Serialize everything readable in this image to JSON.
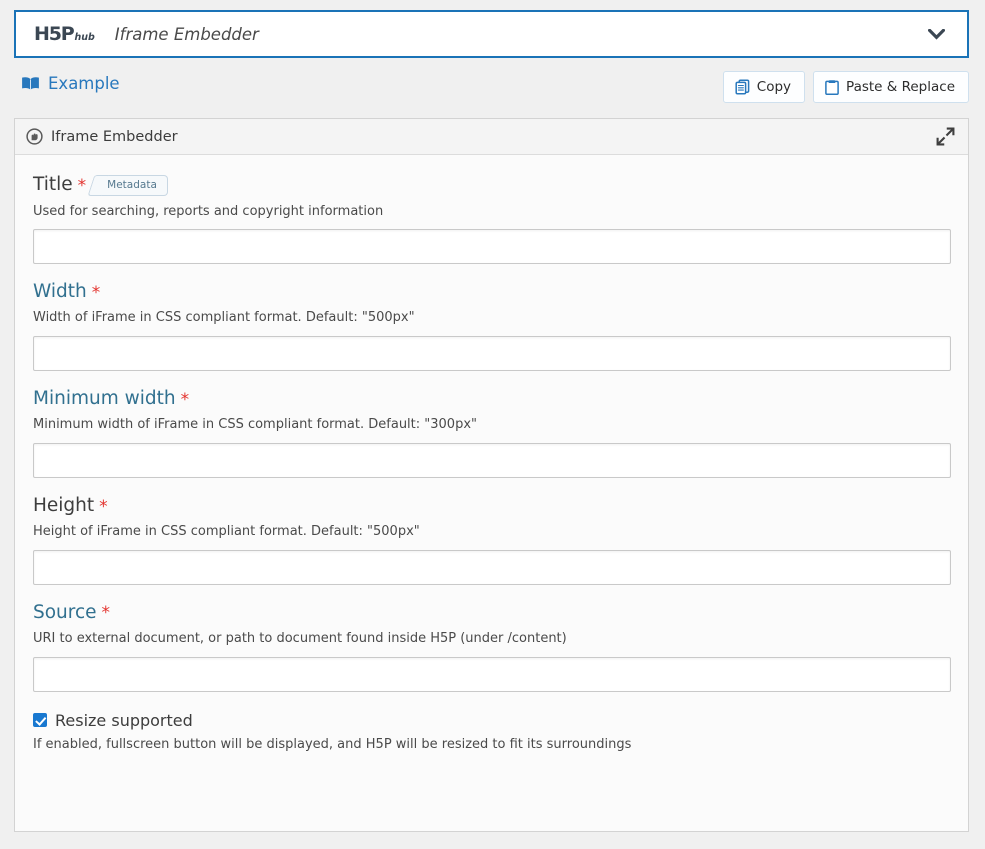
{
  "hub_header": {
    "logo_text": "H5P",
    "logo_sub": "hub",
    "title": "Iframe Embedder",
    "chevron_icon": "chevron-down-icon",
    "border_color": "#1a73b7"
  },
  "action_bar": {
    "example_label": "Example",
    "example_icon": "book-icon",
    "example_color": "#2878bd",
    "buttons": [
      {
        "label": "Copy",
        "icon": "copy-icon"
      },
      {
        "label": "Paste & Replace",
        "icon": "clipboard-icon"
      }
    ]
  },
  "panel": {
    "icon": "iframe-embedder-icon",
    "title": "Iframe Embedder",
    "expand_icon": "expand-diagonal-icon"
  },
  "fields": [
    {
      "name": "title",
      "label": "Title",
      "required_marker": "*",
      "label_style": "dark",
      "badge": "Metadata",
      "description": "Used for searching, reports and copyright information",
      "value": "",
      "placeholder": ""
    },
    {
      "name": "width",
      "label": "Width",
      "required_marker": "*",
      "label_style": "blue",
      "badge": "",
      "description": "Width of iFrame in CSS compliant format. Default: \"500px\"",
      "value": "",
      "placeholder": ""
    },
    {
      "name": "minimum-width",
      "label": "Minimum width",
      "required_marker": "*",
      "label_style": "blue",
      "badge": "",
      "description": "Minimum width of iFrame in CSS compliant format. Default: \"300px\"",
      "value": "",
      "placeholder": ""
    },
    {
      "name": "height",
      "label": "Height",
      "required_marker": "*",
      "label_style": "dark",
      "badge": "",
      "description": "Height of iFrame in CSS compliant format. Default: \"500px\"",
      "value": "",
      "placeholder": ""
    },
    {
      "name": "source",
      "label": "Source",
      "required_marker": "*",
      "label_style": "blue",
      "badge": "",
      "description": "URI to external document, or path to document found inside H5P (under /content)",
      "value": "",
      "placeholder": ""
    }
  ],
  "checkbox_field": {
    "label": "Resize supported",
    "checked": true,
    "description": "If enabled, fullscreen button will be displayed, and H5P will be resized to fit its surroundings",
    "accent_color": "#1878d0"
  }
}
